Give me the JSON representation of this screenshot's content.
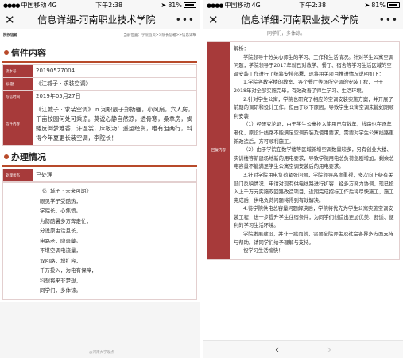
{
  "status": {
    "carrier": "中国移动",
    "network": "4G",
    "time": "下午2:38",
    "battery": "81%"
  },
  "nav": {
    "title": "信息详细-河南职业技术学院",
    "close_icon": "close-icon",
    "more_icon": "more-icon"
  },
  "breadcrumb": {
    "left": "院长信箱",
    "right": "当前位置：学院首页>>院长信箱>>信息详细"
  },
  "letter": {
    "heading": "信件内容",
    "rows": [
      {
        "label": "流水号",
        "value": "20190527004"
      },
      {
        "label": "标  题",
        "value": "《江城子 · 求装空调》"
      },
      {
        "label": "写信时间",
        "value": "2019年05月27日"
      },
      {
        "label": "信件内容",
        "value": "《江城子 · 求装空调》 n 河职靓子郑扬骚，小风扇，六人房，千亩校园何处可乘凉。莫说心静自然凉，透骨寒，桑拿房，蝎蜷反倒梦难香，汗湿裳，床板汤：遥望经贸，唯有泪两行，料得今年夏更长装空调，李院长！"
      }
    ]
  },
  "reply": {
    "heading": "办理情况",
    "status_label": "处理状态",
    "status_value": "已处理",
    "poem": [
      "《江城子 · 未来可期》",
      "眼见学子受酷热，",
      "学院长，心焦愤。",
      "为防酷暑多方奔走忙，",
      "分说原由话且长，",
      "电路老，隐患藏。",
      "不堪空调电流量，",
      "双回路，增扩容，",
      "千万投入，为电有保障，",
      "科想将来非梦想，",
      "同学们，多体谅。"
    ],
    "watermark": "@河南大学观点"
  },
  "right_panel": {
    "top_fragment": "同学们，多体谅。",
    "reply_label": "回复内容",
    "paragraphs": [
      {
        "indent": false,
        "text": "解析："
      },
      {
        "indent": true,
        "text": "学院领导十分关心师生的学习、工作和生活情况。针对学生公寓空调问题，学院领导于2017年就已对教学、餐厅、宿舍等学习生活区域的空调安装工作进行了统筹安排部署，现将相关项目推进情况说明如下："
      },
      {
        "indent": true,
        "text": "1.学院各教学楼的教室、各个餐厅等场所空调的安装工程，已于2018年对全部实施完毕，有效改善了师生学习、生活环境。"
      },
      {
        "indent": true,
        "text": "2.针对学生公寓，学院也研究了相应的空调安装实施方案，并开展了前期的调研和设计工作。但由于以下原因，导致学生公寓空调未能如期顺利安装："
      },
      {
        "indent": true,
        "text": "（1）经研究论证，由于学生公寓投入使用已有数年，线路也在逐年老化，原设计线路不能满足空调安装及使用要求，需要对学生公寓线路重新改造后，方可顺利施工。"
      },
      {
        "indent": true,
        "text": "（2）由于学院在数学楼等区域新增空调数量较多，另有创业大楼、实训楼等新建场地新的用电要求，导致学院用电总负荷急剧增加，剩余总电容量不能满足学生公寓空调安装后的用电要求。"
      },
      {
        "indent": true,
        "text": "3.针对学院用电负荷紧张问题，学院领导高度重视，多次向上级有关部门反映情况，申请对现有供电线路进行扩容，经多方努力协调，现已投入上千万元实施双回路改造项目，近期完成招标工作后将尽快施工，施工完成后，供电负荷问题将得到有效解决。"
      },
      {
        "indent": true,
        "text": "4.待学院供电总容量问题解决后，学院将优先为学生公寓实施空调安装工程，进一步提升学生住宿条件，为同学们创造出更加优美、舒适、便利的学习生活环境。"
      },
      {
        "indent": true,
        "text": "学院发展建设，并非一蹴而就，需要全院师生及社会各界多方面支持与帮助。请同学们给予理解与支持。"
      },
      {
        "indent": true,
        "text": "祝学习生活愉快！"
      }
    ],
    "back_icon": "chevron-left-icon",
    "forward_icon": "chevron-right-icon"
  }
}
